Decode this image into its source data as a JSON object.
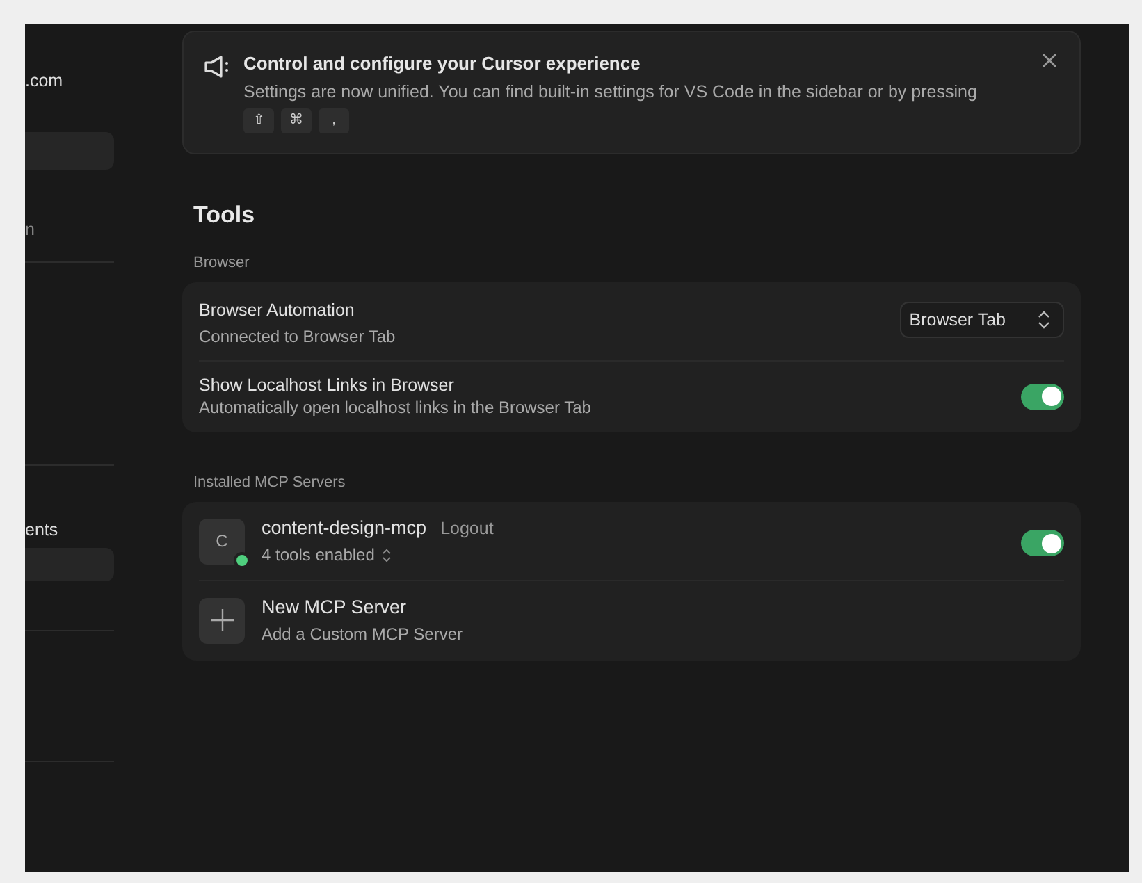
{
  "sidebar": {
    "entries": [
      {
        "kind": "label",
        "text": ".com"
      },
      {
        "kind": "highlight"
      },
      {
        "kind": "label",
        "text": "n"
      },
      {
        "kind": "divider"
      },
      {
        "kind": "divider"
      },
      {
        "kind": "label",
        "text": "ents"
      },
      {
        "kind": "highlight"
      },
      {
        "kind": "divider"
      },
      {
        "kind": "divider"
      }
    ]
  },
  "banner": {
    "title": "Control and configure your Cursor experience",
    "text": "Settings are now unified. You can find built-in settings for VS Code in the sidebar or by pressing",
    "keys": [
      "⇧",
      "⌘",
      ","
    ]
  },
  "page_title": "Tools",
  "sections": [
    {
      "label": "Browser",
      "rows": [
        {
          "kind": "select",
          "title": "Browser Automation",
          "subtitle": "Connected to Browser Tab",
          "value": "Browser Tab"
        },
        {
          "kind": "toggle",
          "title": "Show Localhost Links in Browser",
          "subtitle": "Automatically open localhost links in the Browser Tab",
          "on": true
        }
      ]
    },
    {
      "label": "Installed MCP Servers",
      "rows": [
        {
          "kind": "server",
          "avatar": "C",
          "title": "content-design-mcp",
          "action": "Logout",
          "subtitle": "4 tools enabled",
          "online": true,
          "on": true
        },
        {
          "kind": "add",
          "title": "New MCP Server",
          "subtitle": "Add a Custom MCP Server"
        }
      ]
    }
  ]
}
